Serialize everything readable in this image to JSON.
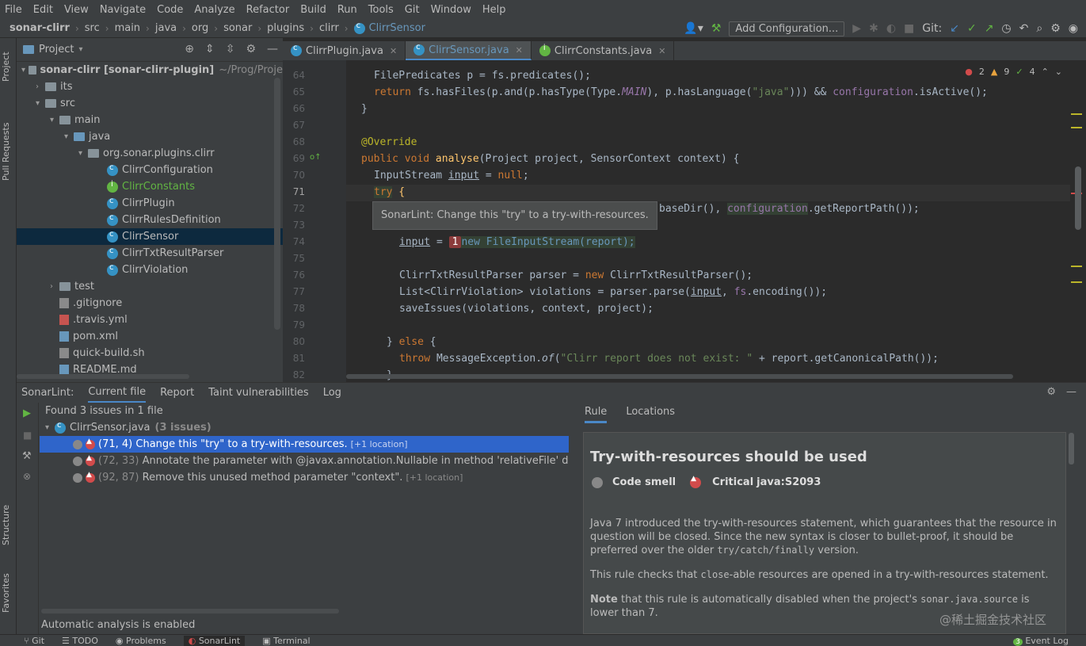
{
  "menu": [
    "File",
    "Edit",
    "View",
    "Navigate",
    "Code",
    "Analyze",
    "Refactor",
    "Build",
    "Run",
    "Tools",
    "Git",
    "Window",
    "Help"
  ],
  "breadcrumbs": [
    "sonar-clirr",
    "src",
    "main",
    "java",
    "org",
    "sonar",
    "plugins",
    "clirr",
    "ClirrSensor"
  ],
  "toolbar": {
    "add_config": "Add Configuration...",
    "git_label": "Git:"
  },
  "left_stripe": {
    "project": "Project",
    "pull_requests": "Pull Requests",
    "structure": "Structure",
    "favorites": "Favorites"
  },
  "project": {
    "title": "Project",
    "tree": [
      {
        "label": "sonar-clirr [sonar-clirr-plugin]",
        "extra": "~/Prog/Proje",
        "type": "folder"
      },
      {
        "label": "its",
        "type": "folder"
      },
      {
        "label": "src",
        "type": "folder"
      },
      {
        "label": "main",
        "type": "folder"
      },
      {
        "label": "java",
        "type": "folder"
      },
      {
        "label": "org.sonar.plugins.clirr",
        "type": "folder"
      },
      {
        "label": "ClirrConfiguration",
        "type": "class"
      },
      {
        "label": "ClirrConstants",
        "type": "interface"
      },
      {
        "label": "ClirrPlugin",
        "type": "class"
      },
      {
        "label": "ClirrRulesDefinition",
        "type": "class"
      },
      {
        "label": "ClirrSensor",
        "type": "class",
        "selected": true
      },
      {
        "label": "ClirrTxtResultParser",
        "type": "class"
      },
      {
        "label": "ClirrViolation",
        "type": "class"
      },
      {
        "label": "test",
        "type": "folder"
      },
      {
        "label": ".gitignore",
        "type": "file"
      },
      {
        "label": ".travis.yml",
        "type": "file"
      },
      {
        "label": "pom.xml",
        "type": "file"
      },
      {
        "label": "quick-build.sh",
        "type": "file"
      },
      {
        "label": "README.md",
        "type": "file"
      }
    ]
  },
  "editor": {
    "tabs": [
      {
        "label": "ClirrPlugin.java",
        "active": false
      },
      {
        "label": "ClirrSensor.java",
        "active": true
      },
      {
        "label": "ClirrConstants.java",
        "active": false
      }
    ],
    "status": {
      "errors": "2",
      "warnings": "9",
      "ok": "4"
    },
    "line_numbers": [
      "64",
      "65",
      "66",
      "67",
      "68",
      "69",
      "70",
      "71",
      "72",
      "73",
      "74",
      "75",
      "76",
      "77",
      "78",
      "79",
      "80",
      "81",
      "82"
    ],
    "lines": {
      "l64": "FilePredicates p = fs.predicates();",
      "l65a": "return ",
      "l65b": "fs.hasFiles(p.and(p.hasType(Type.",
      "l65c": "MAIN",
      "l65d": "), p.hasLanguage(",
      "l65e": "\"java\"",
      "l65f": "))) && ",
      "l65g": "configuration",
      "l65h": ".isActive();",
      "l66": "}",
      "l68": "@Override",
      "l69a": "public void ",
      "l69b": "analyse",
      "l69c": "(Project project, SensorContext context) {",
      "l70a": "InputStream ",
      "l70b": "input",
      "l70c": " = ",
      "l70d": "null",
      "l70e": ";",
      "l71a": "try",
      "l71b": " {",
      "l72a": "baseDir(), ",
      "l72b": "configuration",
      "l72c": ".getReportPath());",
      "l74a": "input",
      "l74b": " = ",
      "l74c": "1",
      "l74d": "new FileInputStream(report);",
      "l76a": "ClirrTxtResultParser parser = ",
      "l76b": "new ",
      "l76c": "ClirrTxtResultParser();",
      "l77a": "List<ClirrViolation> violations = parser.parse(",
      "l77b": "input",
      "l77c": ", ",
      "l77d": "fs",
      "l77e": ".encoding());",
      "l78": "saveIssues(violations, context, project);",
      "l80a": "} ",
      "l80b": "else",
      "l80c": " {",
      "l81a": "throw ",
      "l81b": "MessageException.",
      "l81c": "of",
      "l81d": "(",
      "l81e": "\"Clirr report does not exist: \"",
      "l81f": " + report.getCanonicalPath());",
      "l82": "}"
    },
    "tooltip": "SonarLint: Change this \"try\" to a try-with-resources."
  },
  "sonarlint": {
    "label": "SonarLint:",
    "tabs": [
      "Current file",
      "Report",
      "Taint vulnerabilities",
      "Log"
    ],
    "summary": "Found 3 issues in 1 file",
    "file": "ClirrSensor.java",
    "file_count": "(3 issues)",
    "issues": [
      {
        "pos": "(71, 4)",
        "text": "Change this \"try\" to a try-with-resources.",
        "loc": "[+1 location]"
      },
      {
        "pos": "(72, 33)",
        "text": "Annotate the parameter with @javax.annotation.Nullable in method 'relativeFile' d",
        "loc": ""
      },
      {
        "pos": "(92, 87)",
        "text": "Remove this unused method parameter \"context\".",
        "loc": "[+1 location]"
      }
    ],
    "status": "Automatic analysis is enabled",
    "rule_tabs": [
      "Rule",
      "Locations"
    ],
    "rule": {
      "title": "Try-with-resources should be used",
      "type": "Code smell",
      "severity": "Critical",
      "key": "java:S2093",
      "p1a": "Java 7 introduced the try-with-resources statement, which guarantees that the resource in question will be closed. Since the new syntax is closer to bullet-proof, it should be preferred over the older ",
      "p1b": "try/catch/finally",
      "p1c": " version.",
      "p2a": "This rule checks that ",
      "p2b": "close",
      "p2c": "-able resources are opened in a try-with-resources statement.",
      "p3a": "Note",
      "p3b": " that this rule is automatically disabled when the project's ",
      "p3c": "sonar.java.source",
      "p3d": " is lower than 7."
    },
    "watermark": "@稀土掘金技术社区"
  },
  "statusbar": [
    "Git",
    "TODO",
    "Problems",
    "SonarLint",
    "Terminal",
    "Event Log"
  ],
  "statusbar_event_count": "3"
}
